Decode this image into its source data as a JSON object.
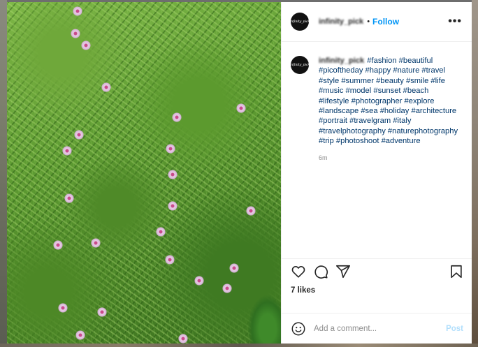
{
  "post": {
    "username": "infinity_pick",
    "avatar_text": "infinity_pick",
    "follow_label": "Follow",
    "separator": "•",
    "more_label": "•••"
  },
  "caption": {
    "username": "infinity_pick",
    "text": "#fashion #beautiful #picoftheday #happy #nature #travel #style #summer #beauty #smile #life #music #model #sunset #beach #lifestyle #photographer #explore #landscape #sea #holiday #architecture #portrait #travelgram #italy #travelphotography #naturephotography #trip #photoshoot #adventure",
    "time_ago": "6m"
  },
  "actions": {
    "icons": [
      "heart-icon",
      "comment-icon",
      "share-icon",
      "bookmark-icon"
    ]
  },
  "likes": {
    "text": "7 likes"
  },
  "comment_box": {
    "placeholder": "Add a comment...",
    "post_label": "Post"
  },
  "colors": {
    "accent": "#0095f6",
    "post_disabled": "#b2dffc",
    "text": "#262626",
    "hashtag": "#00376b",
    "muted": "#8e8e8e"
  }
}
